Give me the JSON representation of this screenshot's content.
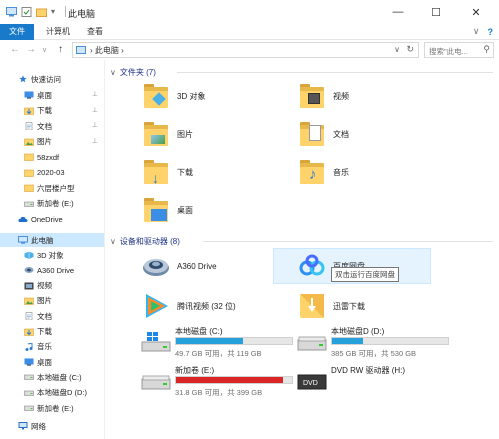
{
  "titlebar": {
    "title": "此电脑",
    "minimize_glyph": "—",
    "maximize_glyph": "☐",
    "close_glyph": "✕"
  },
  "ribbon": {
    "tabs": [
      "文件",
      "计算机",
      "查看"
    ],
    "expand_glyph": "∨",
    "help_glyph": "?"
  },
  "address": {
    "back_glyph": "←",
    "forward_glyph": "→",
    "history_glyph": "∨",
    "up_glyph": "↑",
    "breadcrumb": "›  此电脑  ›",
    "dropdown_glyph": "∨",
    "refresh_glyph": "↻",
    "search_placeholder": "搜索\"此电...",
    "search_glyph": "⚲"
  },
  "sidebar": {
    "quick_access": "快速访问",
    "quick_items": [
      {
        "label": "桌面",
        "icon": "desktop-icon",
        "pinned": true
      },
      {
        "label": "下载",
        "icon": "download-icon",
        "pinned": true
      },
      {
        "label": "文档",
        "icon": "documents-icon",
        "pinned": true
      },
      {
        "label": "图片",
        "icon": "pictures-icon",
        "pinned": true
      },
      {
        "label": "58zxdf",
        "icon": "folder-icon",
        "pinned": false
      },
      {
        "label": "2020-03",
        "icon": "folder-icon",
        "pinned": false
      },
      {
        "label": "六层楼户型",
        "icon": "folder-icon",
        "pinned": false
      },
      {
        "label": "新加卷 (E:)",
        "icon": "drive-icon",
        "pinned": false
      }
    ],
    "onedrive": "OneDrive",
    "this_pc": "此电脑",
    "pc_items": [
      {
        "label": "3D 对象",
        "icon": "3d-objects-icon"
      },
      {
        "label": "A360 Drive",
        "icon": "a360-icon"
      },
      {
        "label": "视频",
        "icon": "videos-icon"
      },
      {
        "label": "图片",
        "icon": "pictures-icon"
      },
      {
        "label": "文档",
        "icon": "documents-icon"
      },
      {
        "label": "下载",
        "icon": "download-icon"
      },
      {
        "label": "音乐",
        "icon": "music-icon"
      },
      {
        "label": "桌面",
        "icon": "desktop-icon"
      },
      {
        "label": "本地磁盘 (C:)",
        "icon": "drive-icon"
      },
      {
        "label": "本地磁盘D (D:)",
        "icon": "drive-icon"
      },
      {
        "label": "新加卷 (E:)",
        "icon": "drive-icon"
      }
    ],
    "network": "网络",
    "pin_glyph": "📌",
    "expand_glyph": "›"
  },
  "main": {
    "folders_header": "文件夹 (7)",
    "folders": [
      {
        "label": "3D 对象",
        "icon": "3d-objects-icon"
      },
      {
        "label": "视频",
        "icon": "videos-icon"
      },
      {
        "label": "图片",
        "icon": "pictures-icon"
      },
      {
        "label": "文档",
        "icon": "documents-icon"
      },
      {
        "label": "下载",
        "icon": "download-icon"
      },
      {
        "label": "音乐",
        "icon": "music-icon"
      },
      {
        "label": "桌面",
        "icon": "desktop-icon"
      }
    ],
    "devices_header": "设备和驱动器 (8)",
    "apps": [
      {
        "label": "A360 Drive",
        "icon": "a360-icon"
      },
      {
        "label": "百度网盘",
        "icon": "baidu-netdisk-icon"
      },
      {
        "label": "腾讯视频 (32 位)",
        "icon": "tencent-video-icon"
      },
      {
        "label": "迅雷下载",
        "icon": "xunlei-icon"
      }
    ],
    "tooltip": "双击运行百度网盘",
    "drives": [
      {
        "name": "本地磁盘 (C:)",
        "size": "49.7 GB 可用，共 119 GB",
        "used_fraction": 0.58,
        "color": "#26a0da",
        "icon": "windows-drive-icon"
      },
      {
        "name": "本地磁盘D (D:)",
        "size": "385 GB 可用，共 530 GB",
        "used_fraction": 0.27,
        "color": "#26a0da",
        "icon": "drive-icon"
      },
      {
        "name": "新加卷 (E:)",
        "size": "31.8 GB 可用，共 399 GB",
        "used_fraction": 0.92,
        "color": "#da2626",
        "icon": "drive-icon"
      },
      {
        "name": "DVD RW 驱动器 (H:)",
        "size": "",
        "used_fraction": null,
        "color": "",
        "icon": "dvd-drive-icon"
      }
    ],
    "collapse_glyph": "∨"
  }
}
